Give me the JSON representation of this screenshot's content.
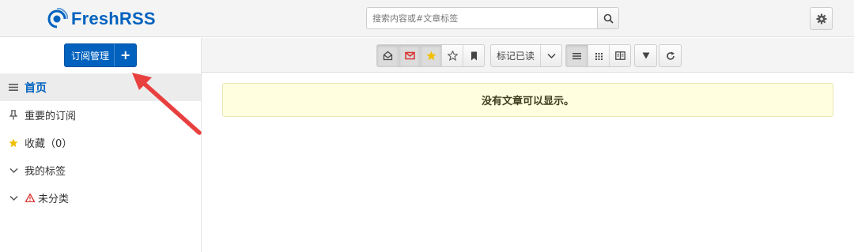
{
  "header": {
    "app_name": "FreshRSS",
    "search_placeholder": "搜索内容或#文章标签",
    "search_icon": "search-icon",
    "settings_icon": "gear-icon"
  },
  "sidebar": {
    "subscription_button": "订阅管理",
    "subscription_add": "+",
    "items": [
      {
        "label": "首页",
        "icon": "menu-icon",
        "active": true
      },
      {
        "label": "重要的订阅",
        "icon": "pin-icon"
      },
      {
        "label": "收藏（0）",
        "icon": "star-icon"
      },
      {
        "label": "我的标签",
        "icon": "chevron-down-icon"
      },
      {
        "label": "未分类",
        "icon": "chevron-down-icon",
        "badge": "warning-icon"
      }
    ]
  },
  "toolbar": {
    "mark_read_label": "标记已读",
    "buttons": [
      "read-icon",
      "unread-icon",
      "star-icon",
      "star-outline-icon",
      "bookmark-icon",
      "chevron-down-icon",
      "list-view-icon",
      "grid-view-icon",
      "reader-view-icon",
      "filter-icon",
      "refresh-icon"
    ]
  },
  "main": {
    "empty_message": "没有文章可以显示。"
  },
  "colors": {
    "brand": "#0062be",
    "notice_bg": "#ffffe0",
    "annotation": "#e8403f"
  }
}
